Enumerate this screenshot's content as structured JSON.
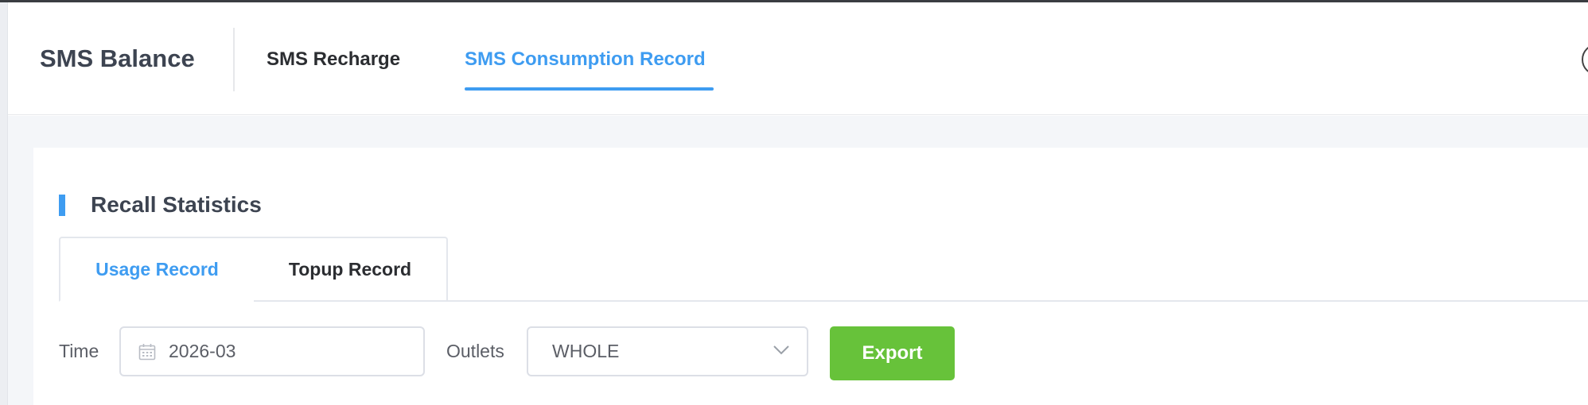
{
  "header": {
    "brand": "SMS Balance",
    "tabs": [
      {
        "label": "SMS Recharge",
        "active": false
      },
      {
        "label": "SMS Consumption Record",
        "active": true
      }
    ]
  },
  "section": {
    "title": "Recall Statistics",
    "tabs": [
      {
        "label": "Usage Record",
        "active": true
      },
      {
        "label": "Topup Record",
        "active": false
      }
    ]
  },
  "filters": {
    "time_label": "Time",
    "time_value": "2026-03",
    "time_icon": "calendar-icon",
    "outlets_label": "Outlets",
    "outlets_value": "WHOLE",
    "outlets_icon": "chevron-down-icon",
    "export_label": "Export"
  },
  "colors": {
    "accent": "#3e9cf1",
    "export_button": "#67c23a"
  }
}
